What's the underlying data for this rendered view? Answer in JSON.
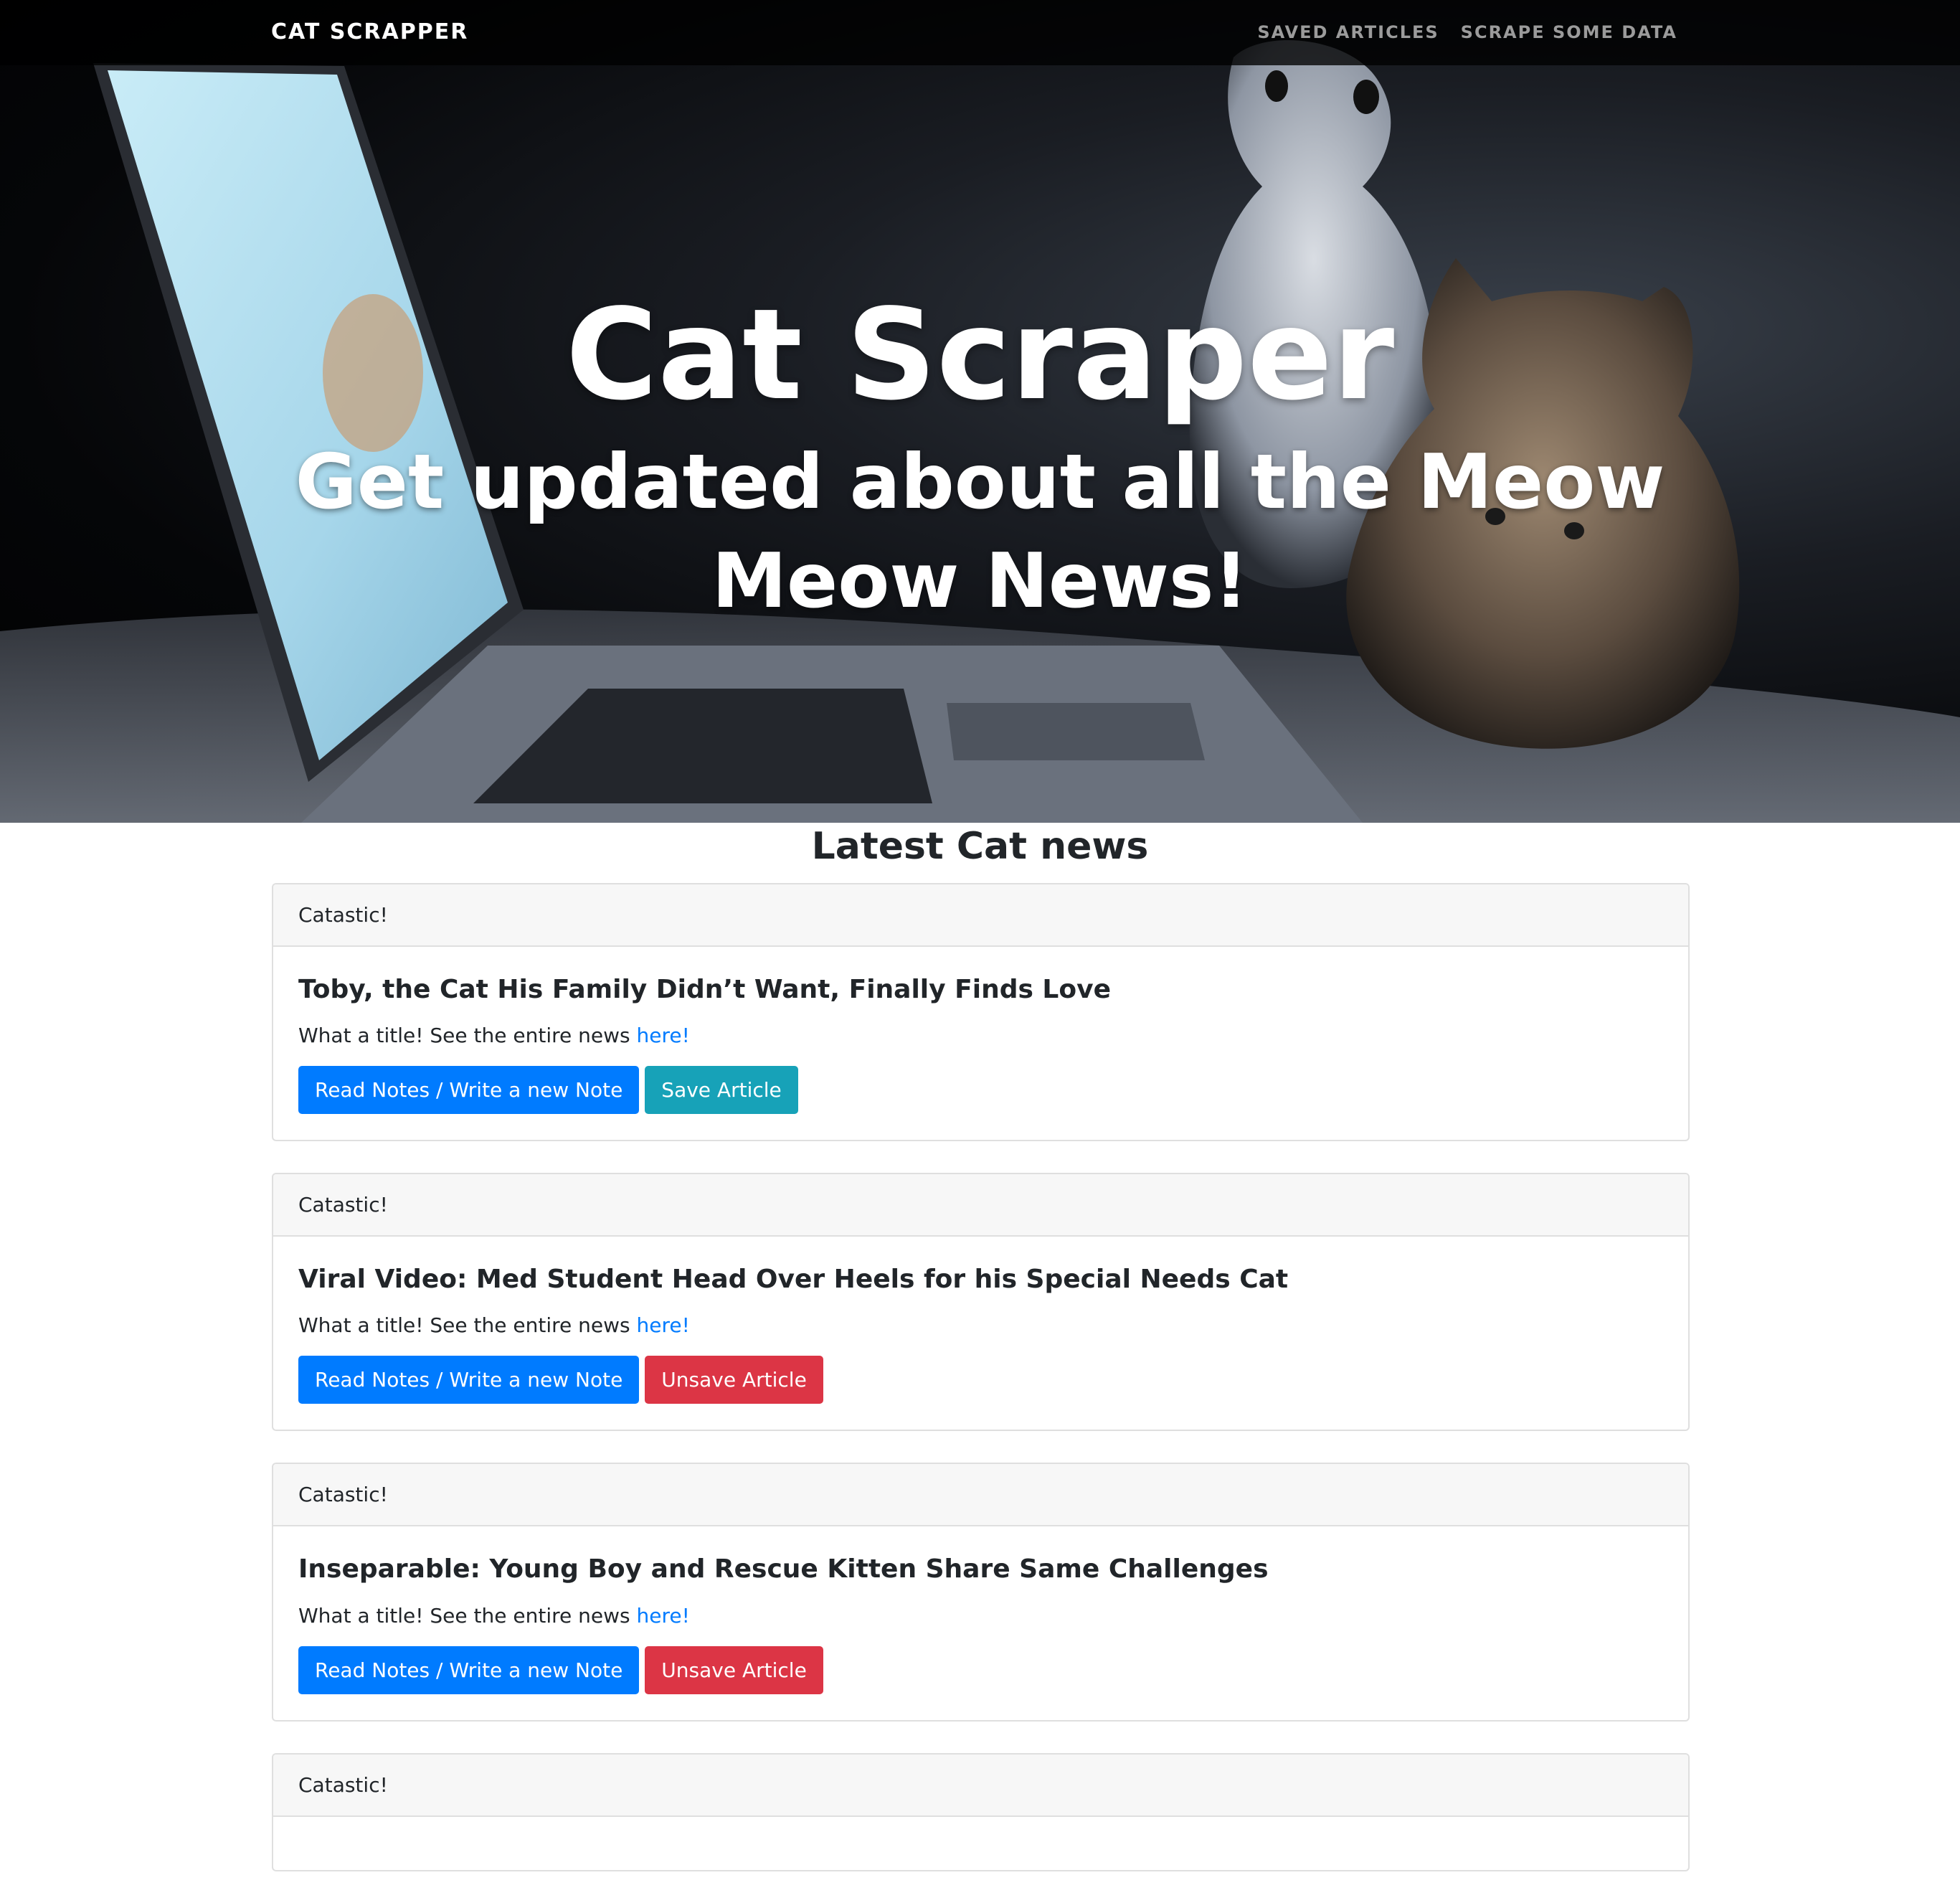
{
  "navbar": {
    "brand": "CAT SCRAPPER",
    "links": [
      "SAVED ARTICLES",
      "SCRAPE SOME DATA"
    ]
  },
  "hero": {
    "title": "Cat Scraper",
    "subtitle": "Get updated about all the Meow Meow News!"
  },
  "section_heading": "Latest Cat news",
  "articles": [
    {
      "header": "Catastic!",
      "title": "Toby, the Cat His Family Didn’t Want, Finally Finds Love",
      "text_prefix": "What a title! See the entire news ",
      "link_text": "here!",
      "notes_button": "Read Notes / Write a new Note",
      "save_button": "Save Article",
      "saved": false
    },
    {
      "header": "Catastic!",
      "title": "Viral Video: Med Student Head Over Heels for his Special Needs Cat",
      "text_prefix": "What a title! See the entire news ",
      "link_text": "here!",
      "notes_button": "Read Notes / Write a new Note",
      "save_button": "Unsave Article",
      "saved": true
    },
    {
      "header": "Catastic!",
      "title": "Inseparable: Young Boy and Rescue Kitten Share Same Challenges",
      "text_prefix": "What a title! See the entire news ",
      "link_text": "here!",
      "notes_button": "Read Notes / Write a new Note",
      "save_button": "Unsave Article",
      "saved": true
    },
    {
      "header": "Catastic!",
      "title": "",
      "text_prefix": "",
      "link_text": "",
      "notes_button": "",
      "save_button": "",
      "saved": false
    }
  ],
  "colors": {
    "primary": "#007bff",
    "info": "#17a2b8",
    "danger": "#dc3545",
    "link": "#007bff",
    "nav_link": "#9b9b9b"
  }
}
